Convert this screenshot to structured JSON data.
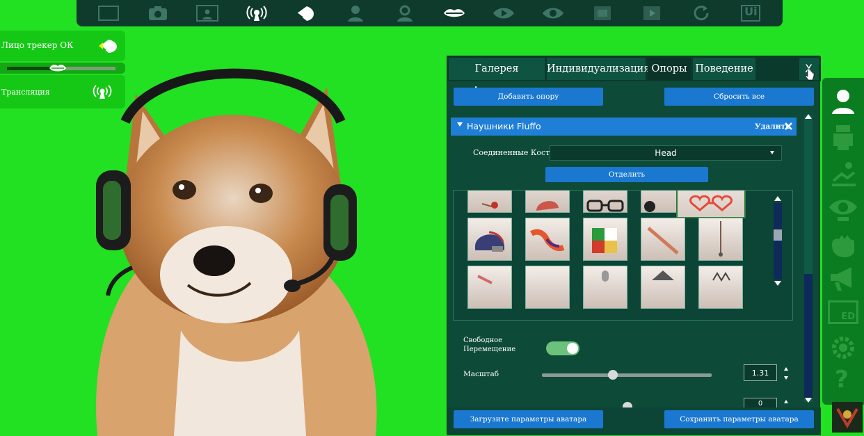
{
  "top_toolbar": {
    "icons": [
      "fullscreen-icon",
      "camera-icon",
      "photo-frame-icon",
      "broadcast-icon",
      "face-tracker-icon",
      "avatar-icon",
      "avatar-settings-icon",
      "lips-icon",
      "eye-play-icon",
      "eye-icon",
      "film-icon",
      "film-play-icon",
      "refresh-icon",
      "ui-icon"
    ],
    "ui_label": "Ui"
  },
  "left_panel": {
    "face_tracker_label": "Лицо трекер ОК",
    "slider_value": 0.45,
    "broadcast_label": "Трансляция"
  },
  "panel": {
    "tabs": [
      {
        "label": "Галерея Аватаров"
      },
      {
        "label": "Индивидуализация"
      },
      {
        "label": "Опоры"
      },
      {
        "label": "Поведение"
      }
    ],
    "close_label": "X",
    "add_prop_label": "Добавить опору",
    "reset_all_label": "Сбросить все",
    "accordion": {
      "title": "Наушники Fluffo",
      "delete_label": "Удалить"
    },
    "bones_label": "Соединенные Кости",
    "bones_value": "Head",
    "detach_label": "Отделить",
    "free_move_label_1": "Свободное",
    "free_move_label_2": "Перемещение",
    "free_move_on": true,
    "scale_label": "Масштаб",
    "scale_value": "1.31",
    "scale_fraction": 0.42,
    "next_value": "0",
    "load_label": "Загрузите параметры аватара",
    "save_label": "Сохранить параметры аватара"
  },
  "right_sidebar": {
    "icons": [
      "user-icon",
      "avatar-body-icon",
      "pose-icon",
      "eye-cam-icon",
      "hand-icon",
      "megaphone-icon",
      "ed-icon",
      "settings-icon",
      "help-icon"
    ],
    "ed_label": "ED",
    "help_label": "?"
  },
  "colors": {
    "green_screen": "#22e022",
    "panel_bg": "#0d4a38",
    "accent_blue": "#1a78d0",
    "toggle_green": "#6cc27a"
  }
}
